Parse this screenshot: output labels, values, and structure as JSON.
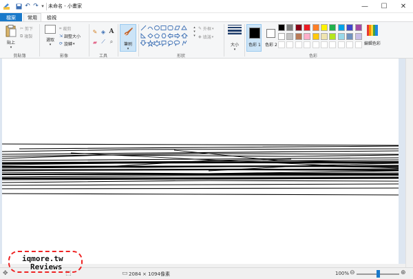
{
  "window": {
    "title": "未命名 - 小畫家",
    "qa_icons": [
      "paint-app-icon",
      "save-icon",
      "undo-icon",
      "redo-icon",
      "customize-icon"
    ],
    "controls": {
      "minimize": "—",
      "maximize": "☐",
      "close": "✕"
    }
  },
  "tabs": {
    "file": "檔案",
    "home": "常用",
    "view": "檢視"
  },
  "ribbon": {
    "clipboard": {
      "paste": "貼上",
      "cut": "剪下",
      "copy": "複製",
      "label": "剪貼簿"
    },
    "image": {
      "select": "選取",
      "crop": "裁剪",
      "resize": "調整大小",
      "rotate": "旋轉",
      "label": "影像"
    },
    "tools": {
      "label": "工具"
    },
    "brushes": {
      "label": "筆刷"
    },
    "shapes": {
      "outline": "外框",
      "fill": "填滿",
      "label": "形狀"
    },
    "size": {
      "label": "大小"
    },
    "colors": {
      "color1": "色彩 1",
      "color2": "色彩 2",
      "edit": "編輯色彩",
      "label": "色彩",
      "color1_value": "#000000",
      "color2_value": "#ffffff",
      "palette_row1": [
        "#000000",
        "#7f7f7f",
        "#880015",
        "#ed1c24",
        "#ff7f27",
        "#fff200",
        "#22b14c",
        "#00a2e8",
        "#3f48cc",
        "#a349a4"
      ],
      "palette_row2": [
        "#ffffff",
        "#c3c3c3",
        "#b97a57",
        "#ffaec9",
        "#ffc90e",
        "#efe4b0",
        "#b5e61d",
        "#99d9ea",
        "#7092be",
        "#c8bfe7"
      ],
      "palette_row3": [
        "#ffffff",
        "#ffffff",
        "#ffffff",
        "#ffffff",
        "#ffffff",
        "#ffffff",
        "#ffffff",
        "#ffffff",
        "#ffffff",
        "#ffffff"
      ]
    }
  },
  "status": {
    "size": "2084 × 1094像素",
    "zoom": "100%",
    "zoom_fraction": 0.5
  },
  "watermark": {
    "line1": "iqmore.tw",
    "line2": "Reviews"
  }
}
